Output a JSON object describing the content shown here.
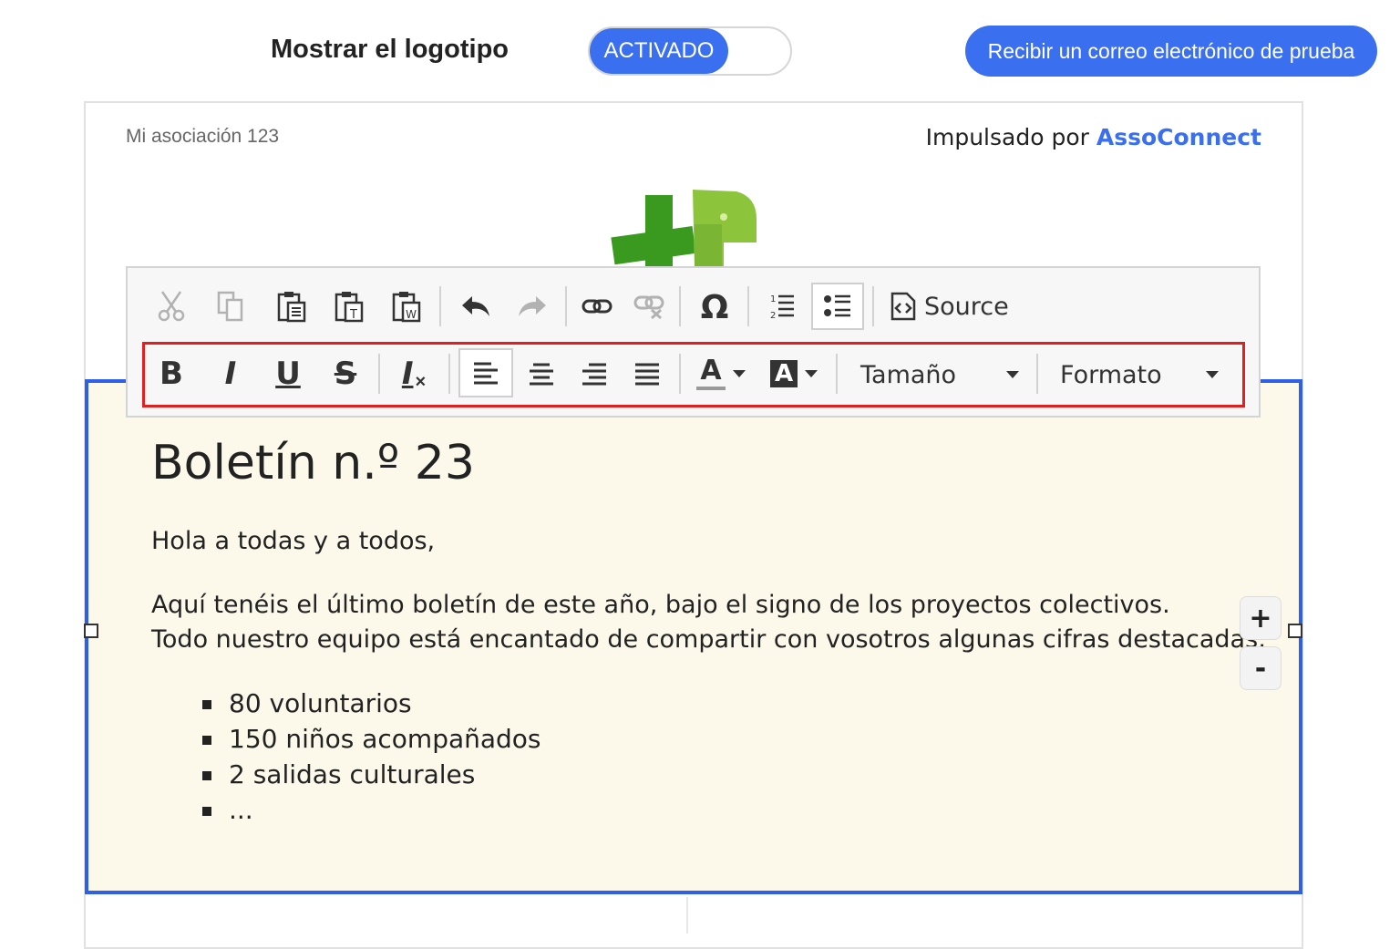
{
  "header": {
    "logo_label": "Mostrar el logotipo",
    "toggle_state": "ACTIVADO",
    "test_email_button": "Recibir un correo electrónico de prueba"
  },
  "email": {
    "association_name": "Mi asociación 123",
    "powered_by_prefix": "Impulsado por",
    "powered_by_brand": "AssoConnect"
  },
  "toolbar": {
    "row1": [
      "scissors-icon",
      "copy-icon",
      "paste-icon",
      "paste-text-icon",
      "paste-word-icon",
      "undo-icon",
      "redo-icon",
      "link-icon",
      "unlink-icon",
      "omega-icon",
      "numbered-list-icon",
      "bulleted-list-icon",
      "source-icon"
    ],
    "source_label": "Source",
    "bold": "B",
    "italic": "I",
    "underline": "U",
    "strike": "S",
    "remove_format": "I",
    "size_label": "Tamaño",
    "format_label": "Formato",
    "text_color_letter": "A",
    "bg_color_letter": "A"
  },
  "content": {
    "title": "Boletín n.º 23",
    "greeting": "Hola a todas y a todos,",
    "paragraph_1": "Aquí tenéis el último boletín de este año, bajo el signo de los proyectos colectivos.",
    "paragraph_2": "Todo nuestro equipo está encantado de compartir con vosotros algunas cifras destacadas:",
    "bullets": [
      "80 voluntarios",
      "150 niños acompañados",
      "2 salidas culturales",
      "..."
    ]
  },
  "zoom": {
    "plus": "+",
    "minus": "-"
  },
  "colors": {
    "accent": "#3a6ff0",
    "block_bg": "#fcf9ea",
    "block_border": "#2f5fe6",
    "highlight": "#e02020"
  }
}
